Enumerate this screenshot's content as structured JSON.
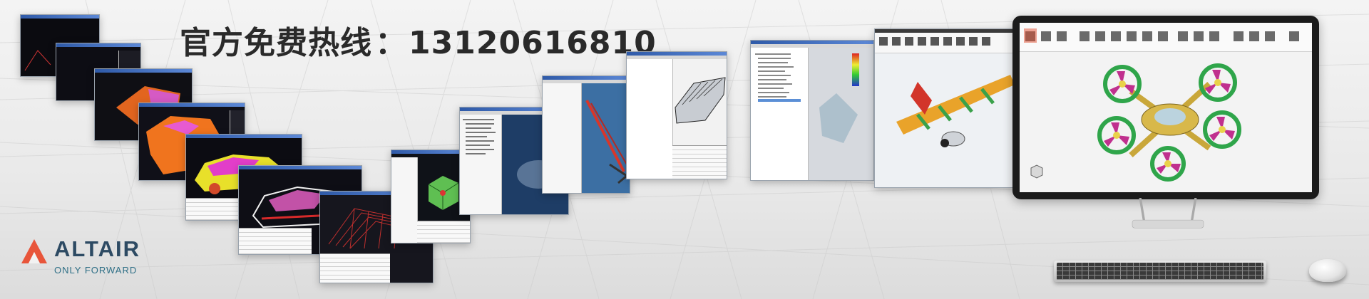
{
  "banner": {
    "hotline_label": "官方免费热线",
    "hotline_separator": "：",
    "hotline_number": "13120616810"
  },
  "logo": {
    "brand": "ALTAIR",
    "tagline": "ONLY FORWARD",
    "brand_color": "#2d4a63",
    "mark_color": "#e8553a"
  },
  "colors": {
    "background": "#ececec",
    "grid_lines": "#cfcfcf",
    "hotline_text": "#2a2a2a",
    "title_bar": "#2f5aa8",
    "monitor_bezel": "#1b1b1b"
  },
  "screenshots": [
    {
      "name": "dark-viewport-1",
      "icon": "mesh-icon"
    },
    {
      "name": "dark-viewport-2",
      "icon": "mesh-icon"
    },
    {
      "name": "orange-part-model",
      "icon": "part-icon"
    },
    {
      "name": "orange-panel-model",
      "icon": "part-icon"
    },
    {
      "name": "car-body-yellow-magenta",
      "icon": "car-icon"
    },
    {
      "name": "car-body-wireframe",
      "icon": "car-icon"
    },
    {
      "name": "red-mesh-surface",
      "icon": "mesh-icon"
    },
    {
      "name": "green-cube-model",
      "icon": "cube-icon"
    },
    {
      "name": "tree-panel-blue-view",
      "icon": "tree-icon"
    },
    {
      "name": "red-crane-structure",
      "icon": "crane-icon"
    },
    {
      "name": "bus-frame-model",
      "icon": "bus-icon"
    },
    {
      "name": "contour-plot-view",
      "icon": "contour-icon"
    },
    {
      "name": "aircraft-wing-model",
      "icon": "wing-icon"
    }
  ],
  "monitor": {
    "subject": "drone-model",
    "icon": "drone-icon"
  }
}
